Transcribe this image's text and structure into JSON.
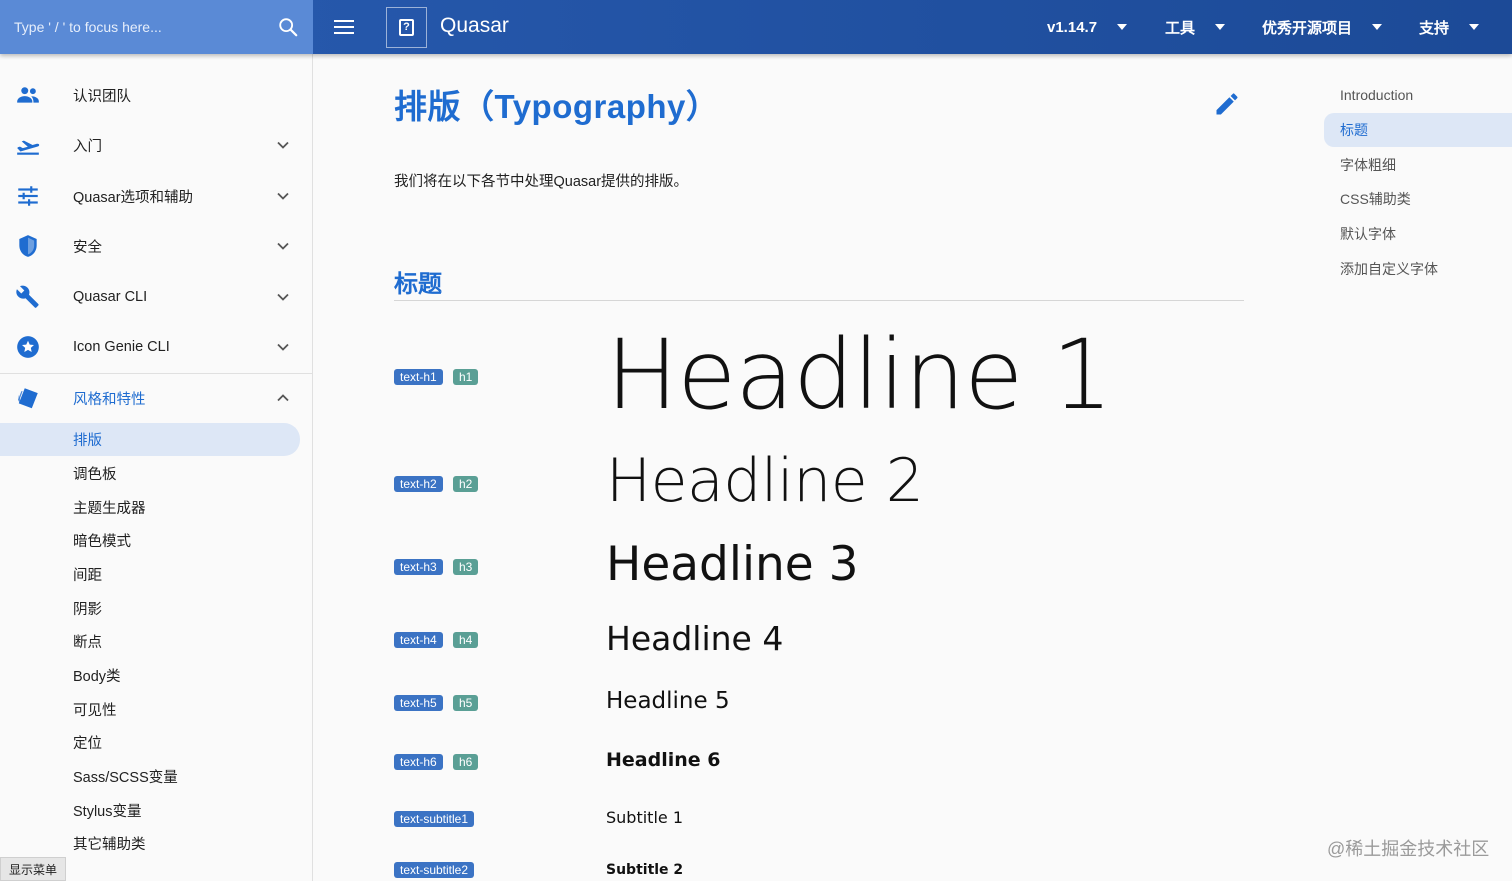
{
  "header": {
    "search_placeholder": "Type ' / ' to focus here...",
    "app_title": "Quasar",
    "nav": [
      {
        "label": "v1.14.7"
      },
      {
        "label": "工具"
      },
      {
        "label": "优秀开源项目"
      },
      {
        "label": "支持"
      }
    ]
  },
  "drawer": {
    "items": [
      {
        "label": "认识团队",
        "icon": "people-icon",
        "expand": false
      },
      {
        "label": "入门",
        "icon": "flight-takeoff-icon",
        "expand": true
      },
      {
        "label": "Quasar选项和辅助",
        "icon": "tune-icon",
        "expand": true
      },
      {
        "label": "安全",
        "icon": "shield-icon",
        "expand": true
      },
      {
        "label": "Quasar CLI",
        "icon": "wrench-icon",
        "expand": true
      },
      {
        "label": "Icon Genie CLI",
        "icon": "star-circle-icon",
        "expand": true
      },
      {
        "label": "风格和特性",
        "icon": "style-icon",
        "expand": true,
        "open": true
      }
    ],
    "sub_items": [
      "排版",
      "调色板",
      "主题生成器",
      "暗色模式",
      "间距",
      "阴影",
      "断点",
      "Body类",
      "可见性",
      "定位",
      "Sass/SCSS变量",
      "Stylus变量",
      "其它辅助类"
    ],
    "show_menu": "显示菜单"
  },
  "main": {
    "title": "排版（Typography）",
    "intro": "我们将在以下各节中处理Quasar提供的排版。",
    "section_title": "标题",
    "rows": [
      {
        "class_badge": "text-h1",
        "tag_badge": "h1",
        "sample": "Headline 1"
      },
      {
        "class_badge": "text-h2",
        "tag_badge": "h2",
        "sample": "Headline 2"
      },
      {
        "class_badge": "text-h3",
        "tag_badge": "h3",
        "sample": "Headline 3"
      },
      {
        "class_badge": "text-h4",
        "tag_badge": "h4",
        "sample": "Headline 4"
      },
      {
        "class_badge": "text-h5",
        "tag_badge": "h5",
        "sample": "Headline 5"
      },
      {
        "class_badge": "text-h6",
        "tag_badge": "h6",
        "sample": "Headline 6"
      },
      {
        "class_badge": "text-subtitle1",
        "tag_badge": "",
        "sample": "Subtitle 1"
      },
      {
        "class_badge": "text-subtitle2",
        "tag_badge": "",
        "sample": "Subtitle 2"
      }
    ]
  },
  "toc": {
    "items": [
      "Introduction",
      "标题",
      "字体粗细",
      "CSS辅助类",
      "默认字体",
      "添加自定义字体"
    ],
    "active_index": 1
  },
  "watermark": "@稀土掘金技术社区",
  "colors": {
    "header": "#1f4e9c",
    "search_bg": "#5a8ad6",
    "primary": "#1f6cd0",
    "badge_class": "#3b73c4",
    "badge_tag": "#5a9f95",
    "selected_bg": "#dde7f6"
  }
}
